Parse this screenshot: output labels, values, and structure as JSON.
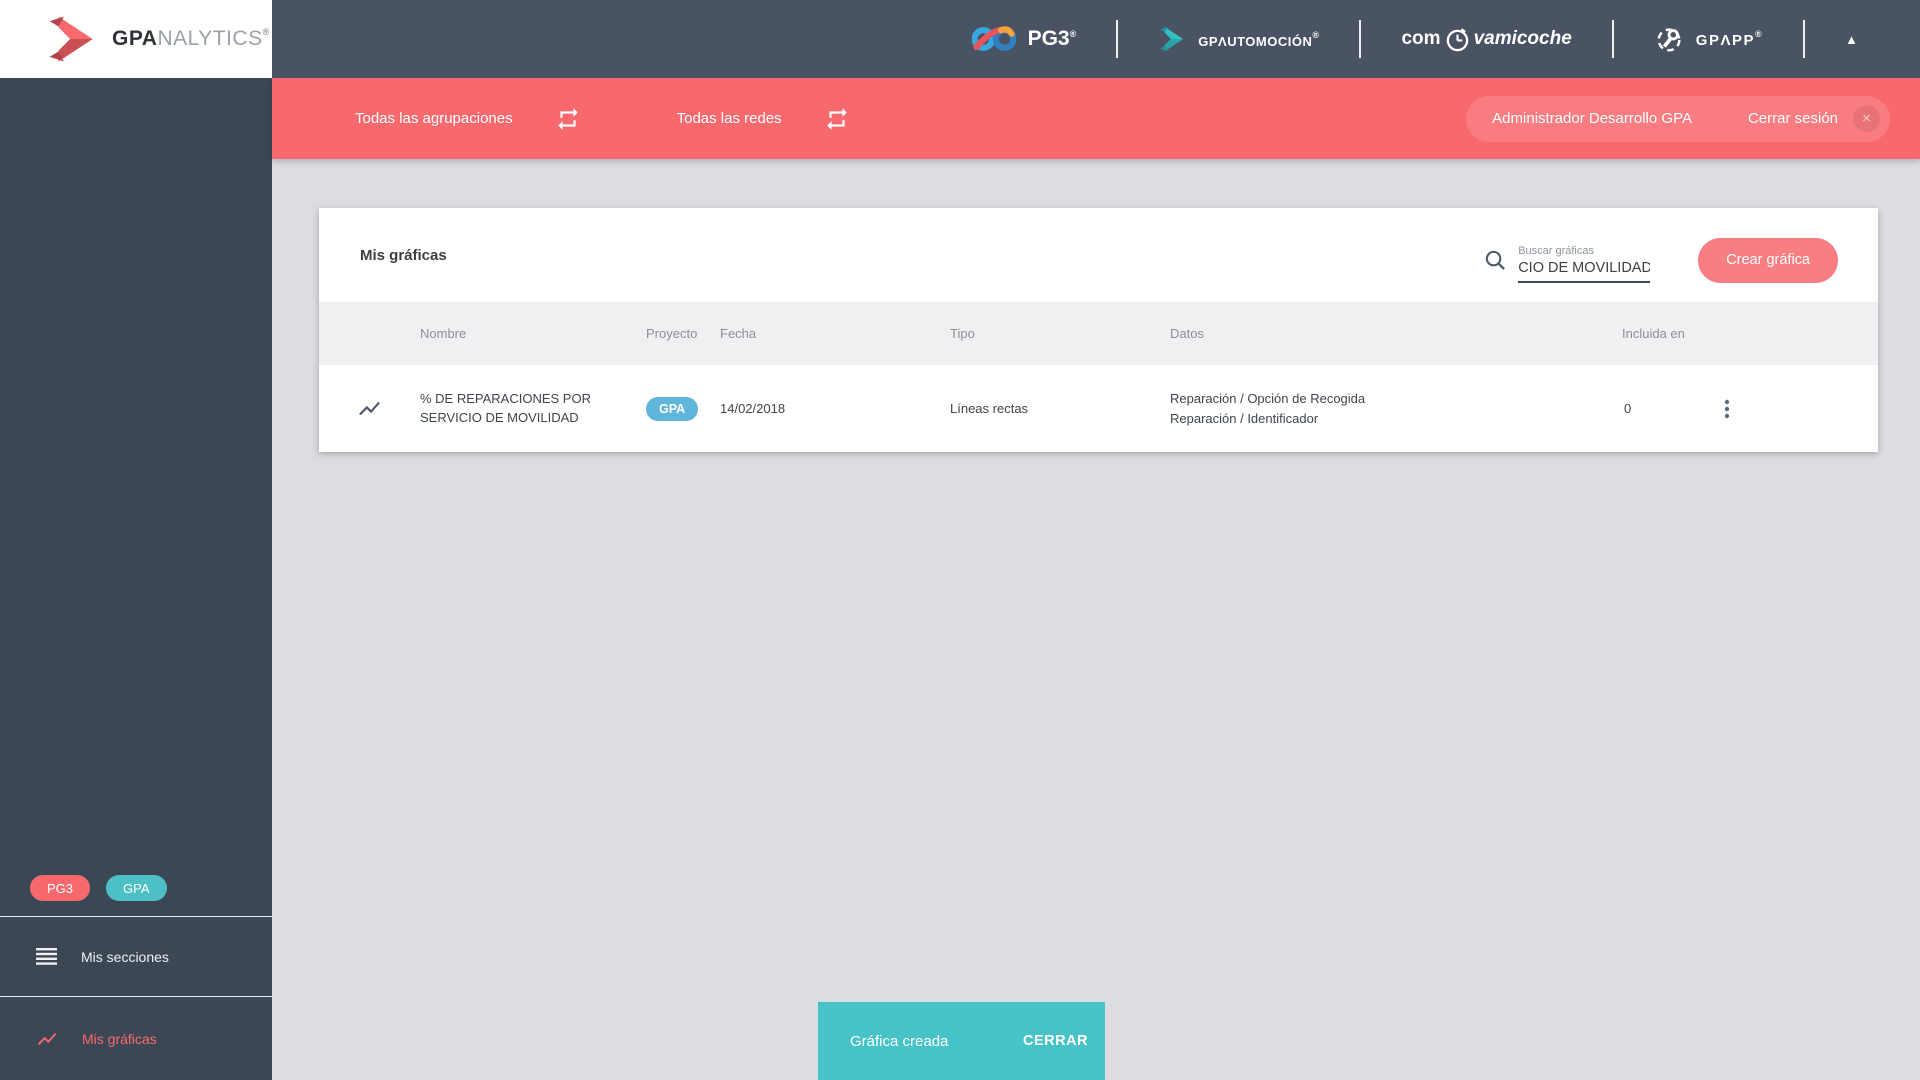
{
  "misc": {
    "reg": "®"
  },
  "icons": {
    "collapse": "▲",
    "close": "×"
  },
  "colors": {
    "accent_red": "#f8696e",
    "toast_teal": "#47c3c8",
    "badge_teal": "#4cc0c5",
    "badge_blue": "#60b5da",
    "header_bg": "#4a5363",
    "sidebar_bg": "#3c4756",
    "page_bg": "#dcdce1"
  },
  "sidebar": {
    "logo": {
      "bold": "GPA",
      "rest": "NALYTICS"
    },
    "badges": [
      {
        "label": "PG3"
      },
      {
        "label": "GPA"
      }
    ],
    "items": [
      {
        "label": "Mis secciones"
      },
      {
        "label": "Mis gráficas"
      }
    ]
  },
  "header": {
    "pg3_label": "PG3",
    "automocion_label": "GPΛUTOMOCIÓN",
    "com_prefix": "com",
    "com_suffix": "vamicoche",
    "gpapp_label": "GPΛPP"
  },
  "filter_bar": {
    "groupings_label": "Todas las agrupaciones",
    "networks_label": "Todas las redes",
    "user_name": "Administrador Desarrollo GPA",
    "logout_label": "Cerrar sesión"
  },
  "main": {
    "card": {
      "title": "Mis gráficas",
      "search": {
        "label": "Buscar gráficas",
        "value": "CIO DE MOVILIDAD"
      },
      "create_button": "Crear gráfica",
      "table": {
        "columns": [
          "Nombre",
          "Proyecto",
          "Fecha",
          "Tipo",
          "Datos",
          "Incluida en"
        ],
        "rows": [
          {
            "name": "% DE REPARACIONES POR SERVICIO DE MOVILIDAD",
            "project": "GPA",
            "date": "14/02/2018",
            "type": "Líneas rectas",
            "data1": "Reparación / Opción de Recogida",
            "data2": "Reparación / Identificador",
            "included_in": "0"
          }
        ]
      }
    }
  },
  "toast": {
    "message": "Gráfica creada",
    "action": "CERRAR"
  }
}
